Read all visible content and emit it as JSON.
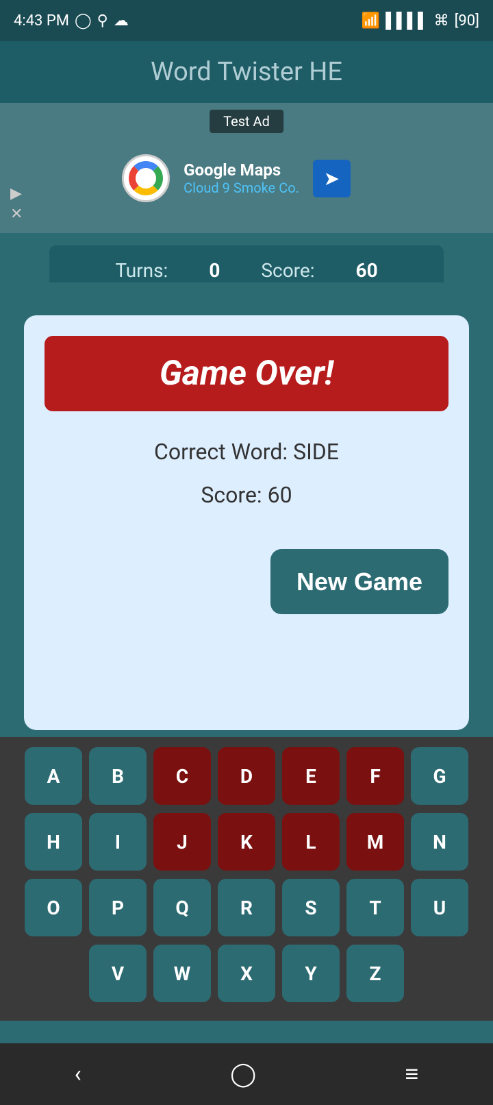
{
  "statusBar": {
    "time": "4:43 PM",
    "battery": "90"
  },
  "header": {
    "title": "Word Twister HE"
  },
  "ad": {
    "label": "Test Ad",
    "company": "Google Maps",
    "subtitle": "Cloud 9 Smoke Co."
  },
  "scoreBar": {
    "turnsLabel": "Turns:",
    "turnsValue": "0",
    "scoreLabel": "Score:",
    "scoreValue": "60"
  },
  "modal": {
    "gameOverText": "Game Over!",
    "correctWordLabel": "Correct Word: SIDE",
    "scoreText": "Score: 60",
    "newGameButton": "New Game"
  },
  "keyboard": {
    "rows": [
      [
        "A",
        "B",
        "C",
        "D",
        "E",
        "F",
        "G"
      ],
      [
        "H",
        "I",
        "J",
        "K",
        "L",
        "M",
        "N"
      ],
      [
        "O",
        "P",
        "Q",
        "R",
        "S",
        "T",
        "U"
      ],
      [
        "V",
        "W",
        "X",
        "Y",
        "Z"
      ]
    ],
    "usedKeys": [
      "C",
      "D",
      "E",
      "F",
      "J",
      "K",
      "L",
      "M"
    ]
  }
}
